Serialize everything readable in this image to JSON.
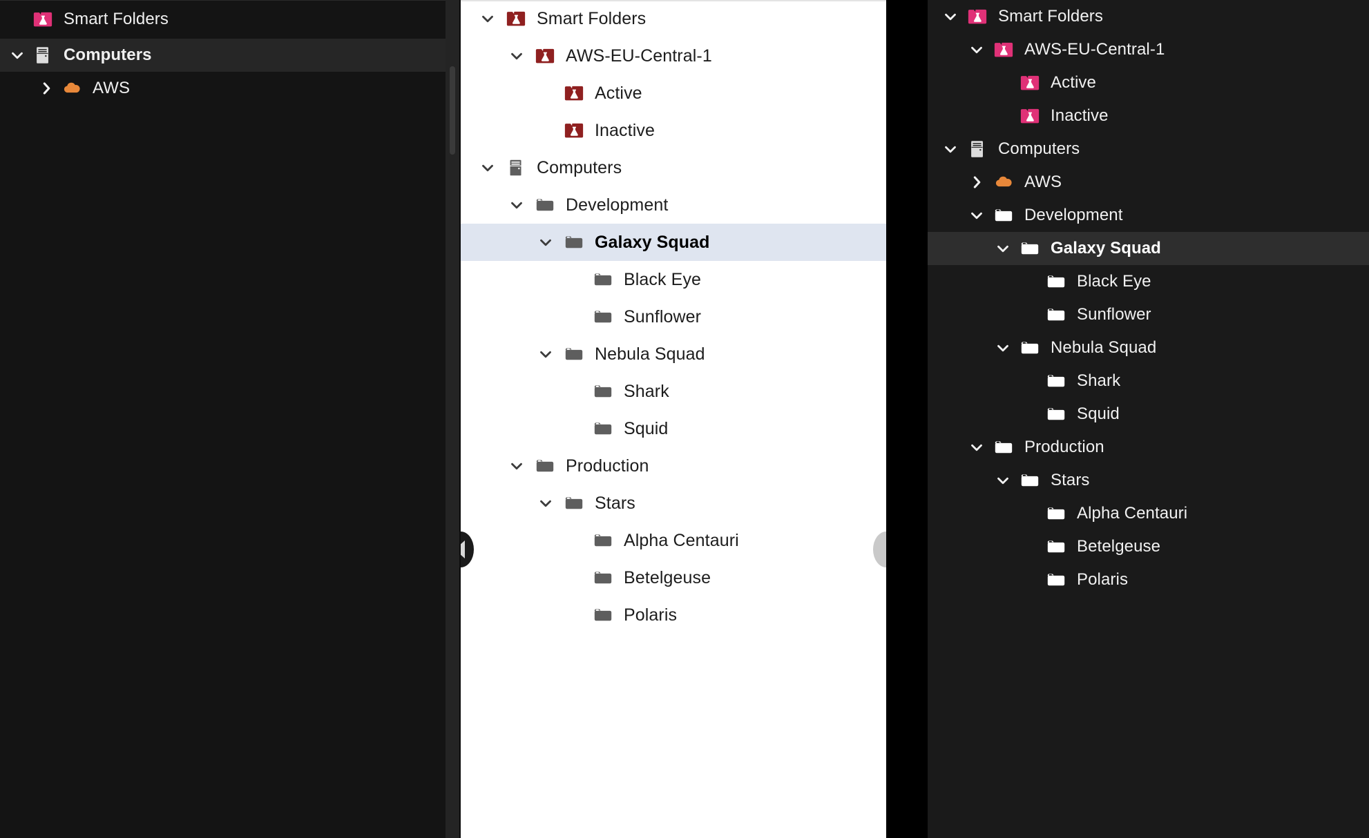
{
  "colors": {
    "left_panel_bg": "#141414",
    "mid_panel_bg": "#ffffff",
    "right_panel_bg": "#1a1a1a",
    "gap_bg": "#000000",
    "smart_folder_pink": "#e03177",
    "smart_folder_darkred": "#8f2020",
    "folder_gray": "#5e5e5e",
    "folder_white": "#ffffff",
    "aws_cloud_orange": "#e8883a",
    "mid_selection_bg": "#dfe5f0",
    "right_selection_bg": "#2e2e2e",
    "left_selection_bg": "#262626"
  },
  "left_panel": {
    "name": "tree-panel-dark-compact",
    "rows": [
      {
        "label": "Smart Folders",
        "icon": "smart-folder-pink-icon",
        "indent": 0,
        "twisty": "none",
        "selected": false
      },
      {
        "label": "Computers",
        "icon": "server-icon",
        "indent": 0,
        "twisty": "expanded",
        "selected": true
      },
      {
        "label": "AWS",
        "icon": "cloud-icon",
        "indent": 1,
        "twisty": "collapsed",
        "selected": false
      }
    ]
  },
  "mid_panel": {
    "name": "tree-panel-light",
    "rows": [
      {
        "label": "Smart Folders",
        "icon": "smart-folder-darkred-icon",
        "indent": 0,
        "twisty": "expanded",
        "selected": false
      },
      {
        "label": "AWS-EU-Central-1",
        "icon": "smart-folder-darkred-icon",
        "indent": 1,
        "twisty": "expanded",
        "selected": false
      },
      {
        "label": "Active",
        "icon": "smart-folder-darkred-icon",
        "indent": 2,
        "twisty": "none",
        "selected": false
      },
      {
        "label": "Inactive",
        "icon": "smart-folder-darkred-icon",
        "indent": 2,
        "twisty": "none",
        "selected": false
      },
      {
        "label": "Computers",
        "icon": "server-icon",
        "indent": 0,
        "twisty": "expanded",
        "selected": false
      },
      {
        "label": "Development",
        "icon": "folder-gray-icon",
        "indent": 1,
        "twisty": "expanded",
        "selected": false
      },
      {
        "label": "Galaxy Squad",
        "icon": "folder-gray-icon",
        "indent": 2,
        "twisty": "expanded",
        "selected": true
      },
      {
        "label": "Black Eye",
        "icon": "folder-gray-icon",
        "indent": 3,
        "twisty": "none",
        "selected": false
      },
      {
        "label": "Sunflower",
        "icon": "folder-gray-icon",
        "indent": 3,
        "twisty": "none",
        "selected": false
      },
      {
        "label": "Nebula Squad",
        "icon": "folder-gray-icon",
        "indent": 2,
        "twisty": "expanded",
        "selected": false
      },
      {
        "label": "Shark",
        "icon": "folder-gray-icon",
        "indent": 3,
        "twisty": "none",
        "selected": false
      },
      {
        "label": "Squid",
        "icon": "folder-gray-icon",
        "indent": 3,
        "twisty": "none",
        "selected": false
      },
      {
        "label": "Production",
        "icon": "folder-gray-icon",
        "indent": 1,
        "twisty": "expanded",
        "selected": false
      },
      {
        "label": "Stars",
        "icon": "folder-gray-icon",
        "indent": 2,
        "twisty": "expanded",
        "selected": false
      },
      {
        "label": "Alpha Centauri",
        "icon": "folder-gray-icon",
        "indent": 3,
        "twisty": "none",
        "selected": false
      },
      {
        "label": "Betelgeuse",
        "icon": "folder-gray-icon",
        "indent": 3,
        "twisty": "none",
        "selected": false
      },
      {
        "label": "Polaris",
        "icon": "folder-gray-icon",
        "indent": 3,
        "twisty": "none",
        "selected": false
      }
    ]
  },
  "right_panel": {
    "name": "tree-panel-dark",
    "rows": [
      {
        "label": "Smart Folders",
        "icon": "smart-folder-pink-icon",
        "indent": 0,
        "twisty": "expanded",
        "selected": false
      },
      {
        "label": "AWS-EU-Central-1",
        "icon": "smart-folder-pink-icon",
        "indent": 1,
        "twisty": "expanded",
        "selected": false
      },
      {
        "label": "Active",
        "icon": "smart-folder-pink-icon",
        "indent": 2,
        "twisty": "none",
        "selected": false
      },
      {
        "label": "Inactive",
        "icon": "smart-folder-pink-icon",
        "indent": 2,
        "twisty": "none",
        "selected": false
      },
      {
        "label": "Computers",
        "icon": "server-icon",
        "indent": 0,
        "twisty": "expanded",
        "selected": false
      },
      {
        "label": "AWS",
        "icon": "cloud-icon",
        "indent": 1,
        "twisty": "collapsed",
        "selected": false
      },
      {
        "label": "Development",
        "icon": "folder-white-icon",
        "indent": 1,
        "twisty": "expanded",
        "selected": false
      },
      {
        "label": "Galaxy Squad",
        "icon": "folder-white-icon",
        "indent": 2,
        "twisty": "expanded",
        "selected": true
      },
      {
        "label": "Black Eye",
        "icon": "folder-white-icon",
        "indent": 3,
        "twisty": "none",
        "selected": false
      },
      {
        "label": "Sunflower",
        "icon": "folder-white-icon",
        "indent": 3,
        "twisty": "none",
        "selected": false
      },
      {
        "label": "Nebula Squad",
        "icon": "folder-white-icon",
        "indent": 2,
        "twisty": "expanded",
        "selected": false
      },
      {
        "label": "Shark",
        "icon": "folder-white-icon",
        "indent": 3,
        "twisty": "none",
        "selected": false
      },
      {
        "label": "Squid",
        "icon": "folder-white-icon",
        "indent": 3,
        "twisty": "none",
        "selected": false
      },
      {
        "label": "Production",
        "icon": "folder-white-icon",
        "indent": 1,
        "twisty": "expanded",
        "selected": false
      },
      {
        "label": "Stars",
        "icon": "folder-white-icon",
        "indent": 2,
        "twisty": "expanded",
        "selected": false
      },
      {
        "label": "Alpha Centauri",
        "icon": "folder-white-icon",
        "indent": 3,
        "twisty": "none",
        "selected": false
      },
      {
        "label": "Betelgeuse",
        "icon": "folder-white-icon",
        "indent": 3,
        "twisty": "none",
        "selected": false
      },
      {
        "label": "Polaris",
        "icon": "folder-white-icon",
        "indent": 3,
        "twisty": "none",
        "selected": false
      }
    ]
  },
  "handles": {
    "left_collapse": "collapse-left-handle",
    "right_collapse": "collapse-right-handle"
  }
}
